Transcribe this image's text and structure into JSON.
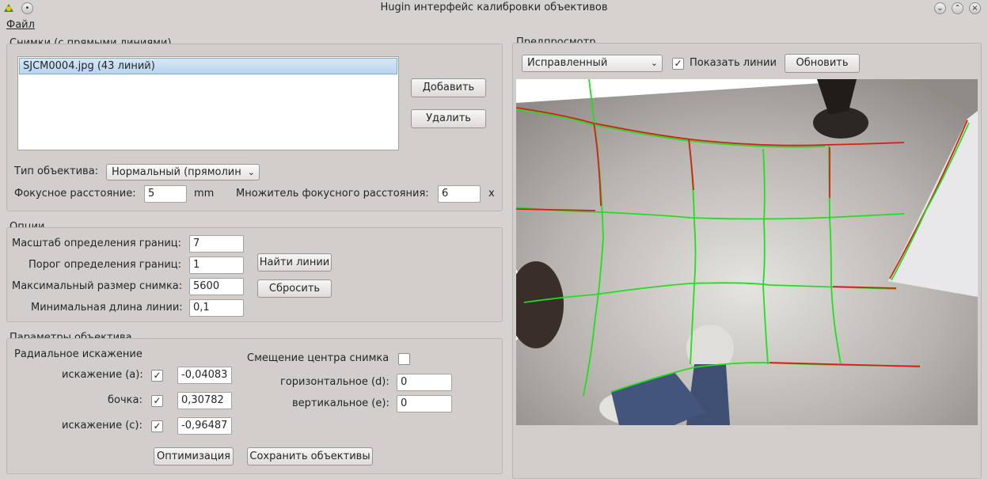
{
  "window": {
    "title": "Hugin интерфейс калибровки объективов",
    "menu": [
      "Файл"
    ]
  },
  "images_group": {
    "title": "Снимки (с прямыми линиями)",
    "items": [
      "SJCM0004.jpg (43 линий)"
    ],
    "add_label": "Добавить",
    "remove_label": "Удалить",
    "lens_type_label": "Тип объектива:",
    "lens_type_value": "Нормальный (прямолин",
    "focal_label": "Фокусное расстояние:",
    "focal_value": "5",
    "focal_unit": "mm",
    "crop_label": "Множитель фокусного расстояния:",
    "crop_value": "6",
    "crop_unit": "x"
  },
  "options_group": {
    "title": "Опции",
    "edge_scale_label": "Масштаб определения границ:",
    "edge_scale_value": "7",
    "edge_threshold_label": "Порог определения границ:",
    "edge_threshold_value": "1",
    "max_size_label": "Максимальный размер снимка:",
    "max_size_value": "5600",
    "min_line_label": "Минимальная длина линии:",
    "min_line_value": "0,1",
    "find_lines_label": "Найти линии",
    "reset_label": "Сбросить"
  },
  "lens_params_group": {
    "title": "Параметры объектива",
    "radial_label": "Радиальное искажение",
    "a_label": "искажение (a):",
    "a_value": "-0,04083",
    "b_label": "бочка:",
    "b_value": "0,30782",
    "c_label": "искажение (c):",
    "c_value": "-0,96487",
    "center_shift_label": "Смещение центра снимка",
    "d_label": "горизонтальное (d):",
    "d_value": "0",
    "e_label": "вертикальное (e):",
    "e_value": "0",
    "optimize_label": "Оптимизация",
    "save_lens_label": "Сохранить объективы"
  },
  "preview_group": {
    "title": "Предпросмотр",
    "mode_value": "Исправленный",
    "show_lines_label": "Показать линии",
    "refresh_label": "Обновить"
  },
  "colors": {
    "line_green": "#22dd22",
    "line_red": "#dd1a1a",
    "selection": "#b9d5ee"
  }
}
